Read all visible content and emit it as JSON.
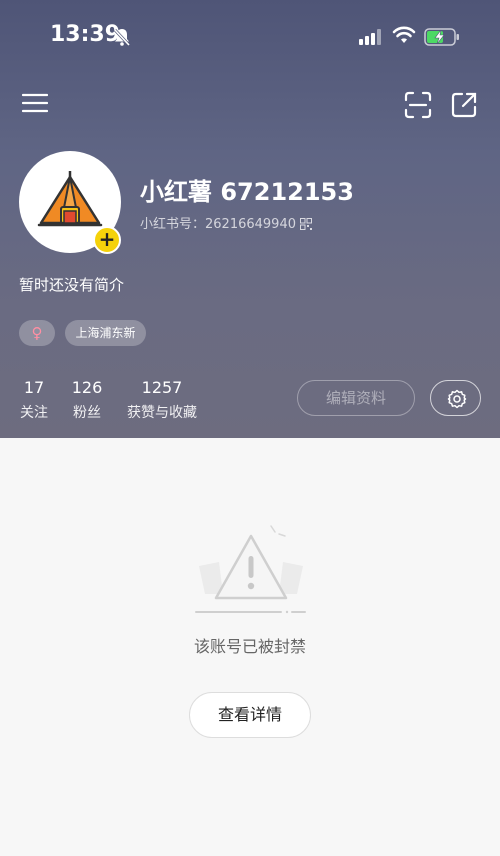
{
  "status_bar": {
    "time": "13:39",
    "icons": [
      "bell-muted-icon",
      "signal-icon",
      "wifi-icon",
      "battery-charging-icon"
    ]
  },
  "top_bar": {
    "icons": [
      "menu-icon",
      "scan-icon",
      "share-icon"
    ]
  },
  "profile": {
    "nickname": "小红薯 67212153",
    "red_id": "小红书号：26216649940",
    "bio": "暂时还没有简介",
    "tags": {
      "gender": "♀",
      "location": "上海浦东新"
    },
    "stats": [
      {
        "num": "17",
        "label": "关注"
      },
      {
        "num": "126",
        "label": "粉丝"
      },
      {
        "num": "1257",
        "label": "获赞与收藏"
      }
    ],
    "edit_button": "编辑资料",
    "avatar_add": "+"
  },
  "content": {
    "empty_text": "该账号已被封禁",
    "detail_button": "查看详情"
  },
  "colors": {
    "header_top": "#4f5577",
    "header_bottom": "#6d6c7f",
    "avatar_add": "#f5d20a",
    "background": "#f7f7f7"
  }
}
